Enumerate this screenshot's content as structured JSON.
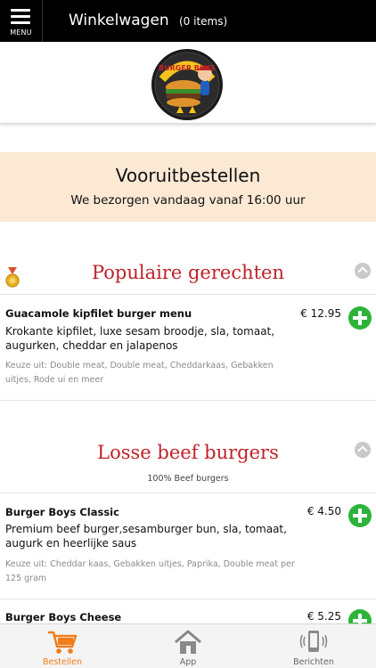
{
  "header": {
    "menu_label": "MENU",
    "title": "Winkelwagen",
    "items_count": "(0 items)"
  },
  "logo": {
    "text": "BURGER BOYS"
  },
  "banner": {
    "title": "Vooruitbestellen",
    "subtitle": "We bezorgen vandaag vanaf 16:00 uur"
  },
  "sections": [
    {
      "title": "Populaire gerechten",
      "subtitle": "",
      "items": [
        {
          "name": "Guacamole kipfilet burger menu",
          "price": "€ 12.95",
          "description": "Krokante kipfilet, luxe sesam broodje, sla, tomaat, augurken, cheddar en jalapenos",
          "options": "Keuze uit: Double meat, Double meat, Cheddarkaas, Gebakken uitjes, Rode ui en meer"
        }
      ]
    },
    {
      "title": "Losse beef burgers",
      "subtitle": "100% Beef burgers",
      "items": [
        {
          "name": "Burger Boys Classic",
          "price": "€ 4.50",
          "description": "Premium beef burger,sesamburger bun, sla, tomaat, augurk en heerlijke saus",
          "options": "Keuze uit: Cheddar kaas, Gebakken uitjes, Paprika, Double meat per 125 gram"
        },
        {
          "name": "Burger Boys Cheese",
          "price": "€ 5.25",
          "description": "",
          "options": ""
        }
      ]
    }
  ],
  "tabs": [
    {
      "label": "Bestellen",
      "icon": "cart-icon",
      "active": true
    },
    {
      "label": "App",
      "icon": "home-icon",
      "active": false
    },
    {
      "label": "Berichten",
      "icon": "phone-notification-icon",
      "active": false
    }
  ],
  "colors": {
    "header_bg": "#000000",
    "banner_bg": "#fbe9d4",
    "section_title": "#c0202a",
    "add_button": "#2db33a",
    "active_tab": "#f07d1a"
  }
}
